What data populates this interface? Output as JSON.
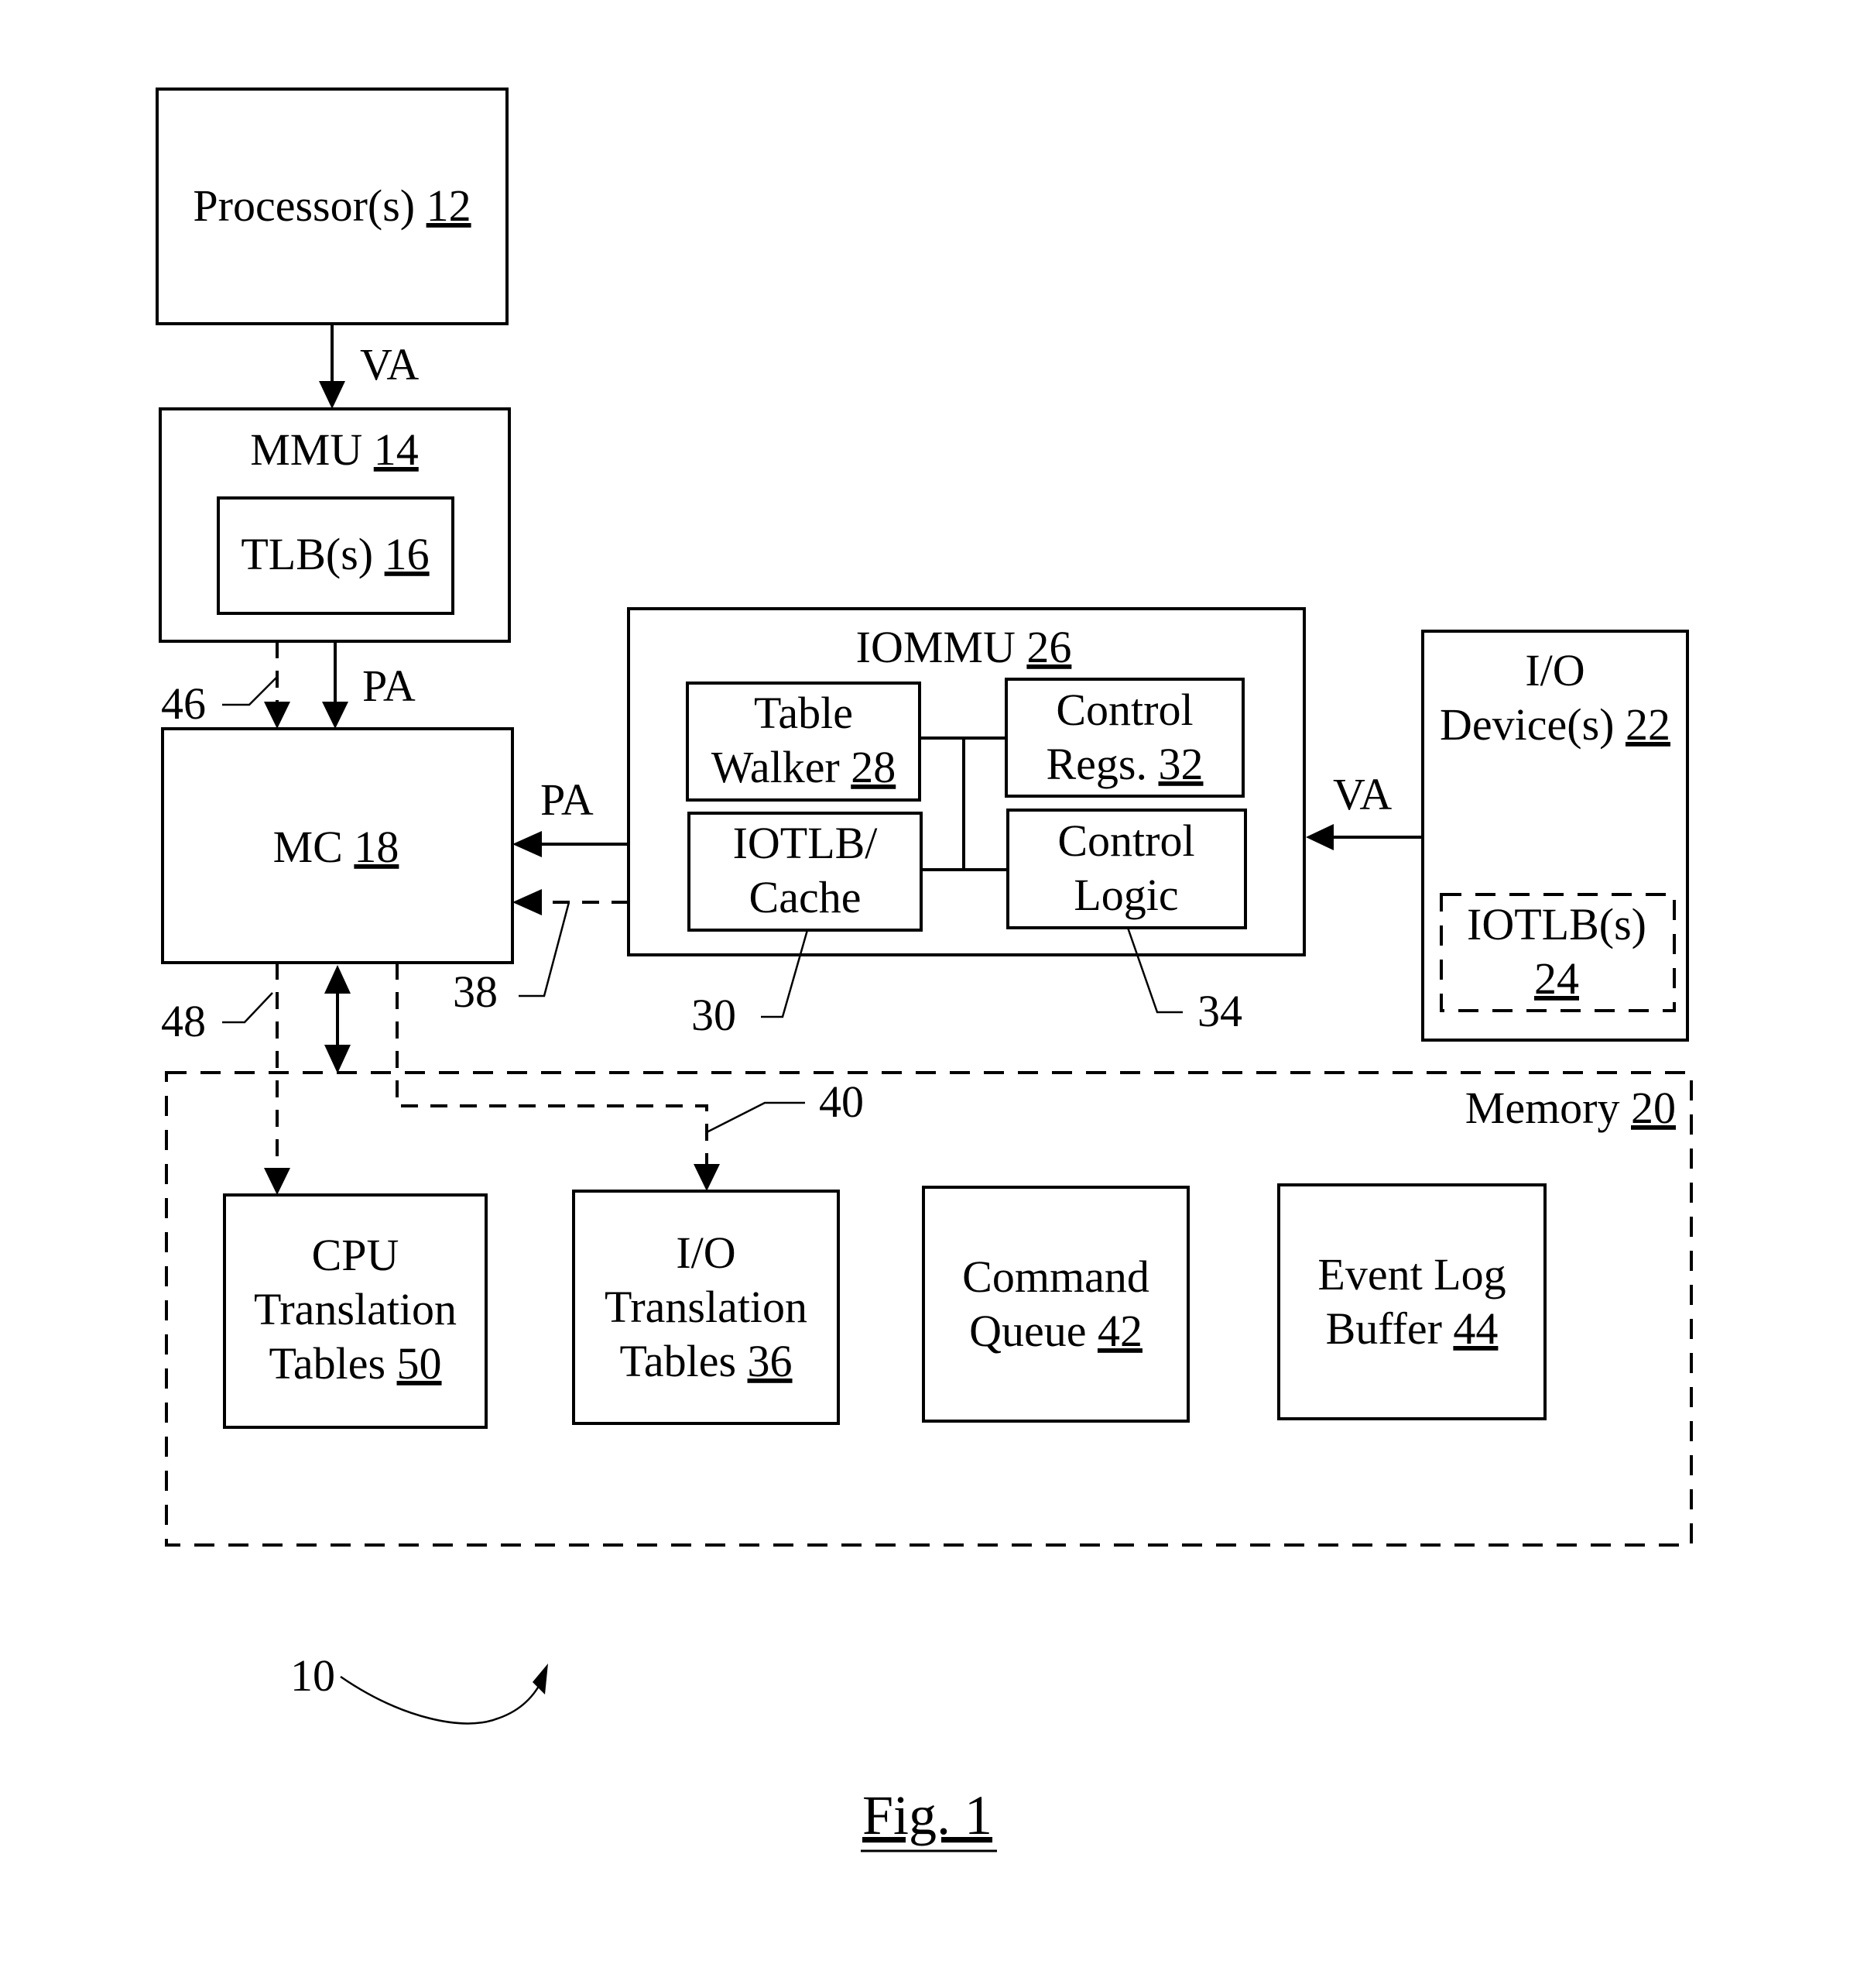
{
  "figure": {
    "caption": "Fig. 1",
    "system_ref": "10"
  },
  "blocks": {
    "processor": {
      "label": "Processor(s)",
      "ref": "12"
    },
    "mmu": {
      "label": "MMU",
      "ref": "14"
    },
    "tlb": {
      "label": "TLB(s)",
      "ref": "16"
    },
    "mc": {
      "label": "MC",
      "ref": "18"
    },
    "memory": {
      "label": "Memory",
      "ref": "20"
    },
    "io_device": {
      "line1": "I/O",
      "label": "Device(s)",
      "ref": "22"
    },
    "io_tlbs": {
      "label": "IOTLB(s)",
      "ref": "24"
    },
    "iommu": {
      "label": "IOMMU",
      "ref": "26"
    },
    "table_walker": {
      "line1": "Table",
      "label": "Walker",
      "ref": "28"
    },
    "iotlb_cache": {
      "line1": "IOTLB/",
      "line2": "Cache",
      "ref": "30"
    },
    "control_regs": {
      "line1": "Control",
      "label": "Regs.",
      "ref": "32"
    },
    "control_logic": {
      "line1": "Control",
      "line2": "Logic",
      "ref": "34"
    },
    "io_translation_tables": {
      "line1": "I/O",
      "line2": "Translation",
      "label": "Tables",
      "ref": "36"
    },
    "command_queue": {
      "line1": "Command",
      "label": "Queue",
      "ref": "42"
    },
    "event_log_buffer": {
      "line1": "Event Log",
      "label": "Buffer",
      "ref": "44"
    },
    "cpu_translation_tables": {
      "line1": "CPU",
      "line2": "Translation",
      "label": "Tables",
      "ref": "50"
    }
  },
  "signals": {
    "proc_to_mmu": "VA",
    "mmu_to_mc": "PA",
    "iommu_to_mc": "PA",
    "io_to_iommu": "VA"
  },
  "callouts": {
    "mmu_walk": "46",
    "iommu_walk": "38",
    "mc_cpu_tables": "48",
    "mc_io_tables": "40"
  }
}
